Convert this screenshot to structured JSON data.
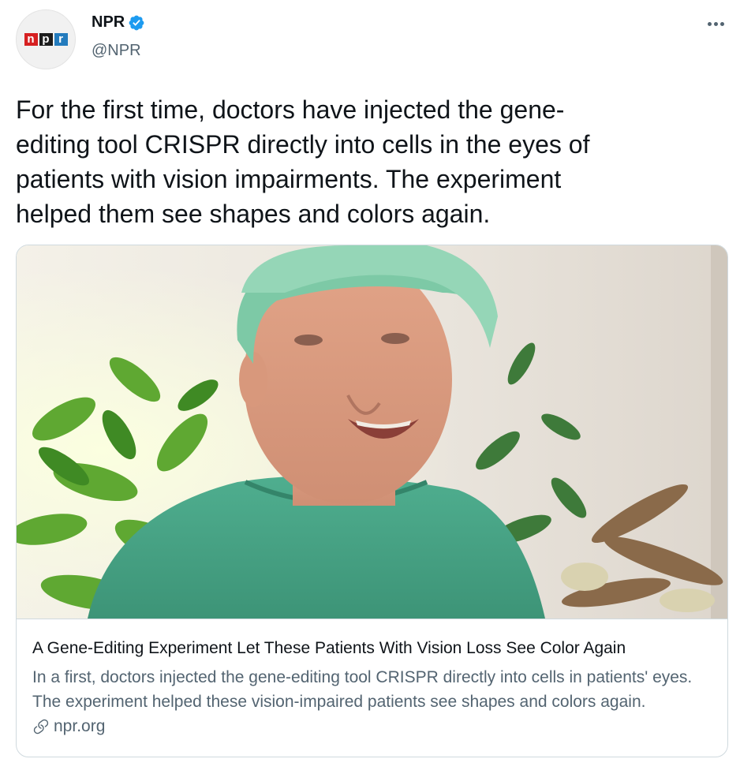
{
  "author": {
    "avatar_icon": "npr-logo-icon",
    "logo_letters": [
      "n",
      "p",
      "r"
    ],
    "logo_colors": [
      "#d62021",
      "#1d1d1d",
      "#237bbd"
    ],
    "display_name": "NPR",
    "verified_icon": "verified-badge-icon",
    "verified_color": "#1d9bf0",
    "handle": "@NPR"
  },
  "menu": {
    "icon": "more-options-icon"
  },
  "tweet": {
    "text": "For the first time, doctors have injected the gene-\nediting tool CRISPR directly into cells in the eyes of\npatients with vision impairments. The experiment\nhelped them see shapes and colors again."
  },
  "link_card": {
    "image_icon": "article-photo",
    "title": "A Gene-Editing Experiment Let These Patients With Vision Loss See Color Again",
    "description": "In a first, doctors injected the gene-editing tool CRISPR directly into cells in patients' eyes. The experiment helped these vision-impaired patients see shapes and colors again.",
    "link_icon": "link-icon",
    "domain": "npr.org"
  },
  "colors": {
    "text_primary": "#0f1419",
    "text_secondary": "#536471",
    "border": "#cfd9de"
  }
}
